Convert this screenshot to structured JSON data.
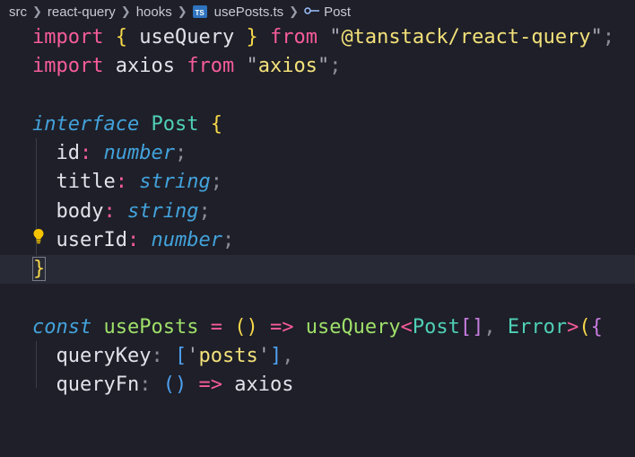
{
  "breadcrumb": {
    "items": [
      "src",
      "react-query",
      "hooks",
      "usePosts.ts",
      "Post"
    ],
    "file_badge": "TS"
  },
  "code": {
    "l1": {
      "import": "import",
      "lb": "{",
      "name": "useQuery",
      "rb": "}",
      "from": "from",
      "q1": "\"",
      "str": "@tanstack/react-query",
      "q2": "\"",
      "semi": ";"
    },
    "l2": {
      "import": "import",
      "name": "axios",
      "from": "from",
      "q1": "\"",
      "str": "axios",
      "q2": "\"",
      "semi": ";"
    },
    "l4": {
      "kw": "interface",
      "name": "Post",
      "lb": "{"
    },
    "l5": {
      "prop": "id",
      "colon": ":",
      "type": "number",
      "semi": ";"
    },
    "l6": {
      "prop": "title",
      "colon": ":",
      "type": "string",
      "semi": ";"
    },
    "l7": {
      "prop": "body",
      "colon": ":",
      "type": "string",
      "semi": ";"
    },
    "l8": {
      "prop": "userId",
      "colon": ":",
      "type": "number",
      "semi": ";"
    },
    "l9": {
      "rb": "}"
    },
    "l11": {
      "kw": "const",
      "name": "usePosts",
      "eq": "=",
      "parens": "()",
      "arrow": "=>",
      "fn": "useQuery",
      "lt": "<",
      "t1": "Post",
      "arr": "[]",
      "comma": ",",
      "t2": "Error",
      "gt": ">",
      "lp": "(",
      "lb": "{"
    },
    "l12": {
      "prop": "queryKey",
      "colon": ":",
      "lb": "[",
      "q1": "'",
      "str": "posts",
      "q2": "'",
      "rb": "]",
      "comma": ","
    },
    "l13": {
      "prop": "queryFn",
      "colon": ":",
      "parens": "()",
      "arrow": "=>",
      "name": "axios"
    }
  },
  "colors": {
    "background": "#1e1f28",
    "current_line": "#282a35",
    "keyword": "#f75c9a",
    "type": "#4fd0b6",
    "string": "#f3e17a",
    "function": "#9fe06a"
  },
  "icons": [
    "typescript-file-icon",
    "symbol-interface-icon",
    "lightbulb-icon"
  ]
}
